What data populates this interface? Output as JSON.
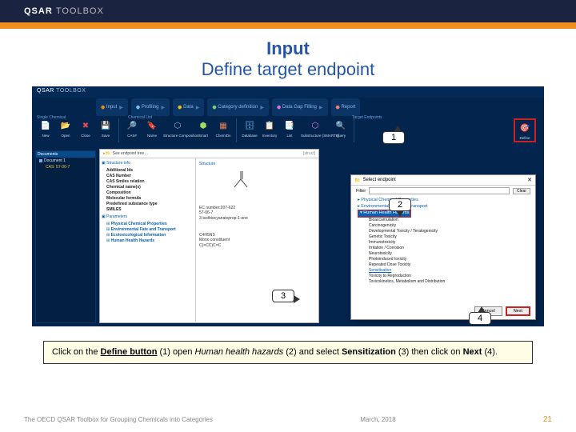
{
  "brand": {
    "prefix": "QSAR",
    "suffix": "TOOLBOX"
  },
  "title": {
    "main": "Input",
    "sub": "Define target endpoint"
  },
  "workflow": [
    "Input",
    "Profiling",
    "Data",
    "Category definition",
    "Data Gap Filling",
    "Report"
  ],
  "seg_labels": {
    "a": "Single Chemical",
    "b": "Chemical List",
    "c": "Target Endpoints"
  },
  "tools": {
    "new": "New",
    "open": "Open",
    "close": "Close",
    "save": "Save",
    "cas": "CAS#",
    "name": "Name",
    "comp": "Structure Composition",
    "smart": "Smart",
    "chemids": "ChemIDs",
    "db": "Database",
    "inv": "Inventory",
    "list": "List",
    "subs": "Substructure (SMARTS)",
    "query": "Query",
    "define": "Define"
  },
  "tree": {
    "tab": "Documents",
    "doc1": "Document 1",
    "cas1": "CAS: 57-06-7"
  },
  "crumb": "See endpoint tree…",
  "crumb2": "[struct]",
  "doc_tree": {
    "structure_info": "Structure info",
    "items1": [
      "Additional Ids",
      "CAS Number",
      "CAS Smiles relation",
      "Chemical name(s)",
      "Composition",
      "Molecular formula",
      "Predefined substance type",
      "SMILES"
    ],
    "parameters": "Parameters",
    "items2": [
      "Physical Chemical Properties",
      "Environmental Fate and Transport",
      "Ecotoxicological Information",
      "Human Health Hazards"
    ]
  },
  "right_vals": {
    "structure_hdr": "Structure",
    "ec": "EC number:207-622",
    "cas": "57-06-7",
    "name": "3-isothiocyanatoprop-1-ene",
    "formula": "C4H5NS",
    "type": "Mono constituent",
    "smiles": "C(=CC)C=C"
  },
  "dialog": {
    "title": "Select endpoint",
    "filter_label": "Filter",
    "filter_placeholder": "",
    "clear": "Clear",
    "roots": {
      "pcp": "Physical Chemical Properties",
      "eft": "Environmental Fate and Transport",
      "hhh": "Human Health Hazards"
    },
    "hhh_children": [
      "Bioaccumulation",
      "Carcinogenicity",
      "Developmental Toxicity / Teratogenicity",
      "Genetic Toxicity",
      "Immunotoxicity",
      "Irritation / Corrosion",
      "Neurotoxicity",
      "Photoinduced toxicity",
      "Repeated Dose Toxicity",
      "Sensitisation",
      "Toxicity to Reproduction",
      "Toxicokinetics, Metabolism and Distribution"
    ],
    "sel_index": 9,
    "next": "Next",
    "cancel": "Cancel"
  },
  "callouts": {
    "c1": "1",
    "c2": "2",
    "c3": "3",
    "c4": "4"
  },
  "instruction": {
    "prefix": "Click on the ",
    "b1": "Define button",
    "mid1": " (1) open ",
    "i1": "Human health hazards",
    "mid2": " (2) and select ",
    "b2": "Sensitization",
    "mid3": " (3) then click on ",
    "b3": "Next",
    "end": " (4)."
  },
  "footer": {
    "left": "The OECD QSAR Toolbox for Grouping Chemicals into Categories",
    "center": "March, 2018",
    "page": "21"
  }
}
